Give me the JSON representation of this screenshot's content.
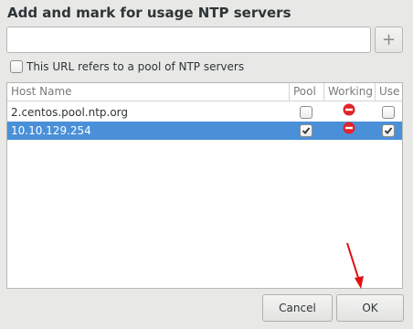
{
  "dialog": {
    "title": "Add and mark for usage NTP servers"
  },
  "url_input": {
    "value": "",
    "placeholder": ""
  },
  "add_button": {
    "label": "+"
  },
  "pool_checkbox": {
    "label": "This URL refers to a pool of NTP servers",
    "checked": false
  },
  "table": {
    "columns": [
      "Host Name",
      "Pool",
      "Working",
      "Use"
    ],
    "rows": [
      {
        "host": "2.centos.pool.ntp.org",
        "pool": false,
        "working": "error-icon",
        "use": false,
        "selected": false
      },
      {
        "host": "10.10.129.254",
        "pool": true,
        "working": "error-icon",
        "use": true,
        "selected": true
      }
    ]
  },
  "footer": {
    "cancel_label": "Cancel",
    "ok_label": "OK"
  },
  "colors": {
    "selection": "#4a90d9",
    "error": "#e0242c",
    "annotation_arrow": "#e01010"
  }
}
